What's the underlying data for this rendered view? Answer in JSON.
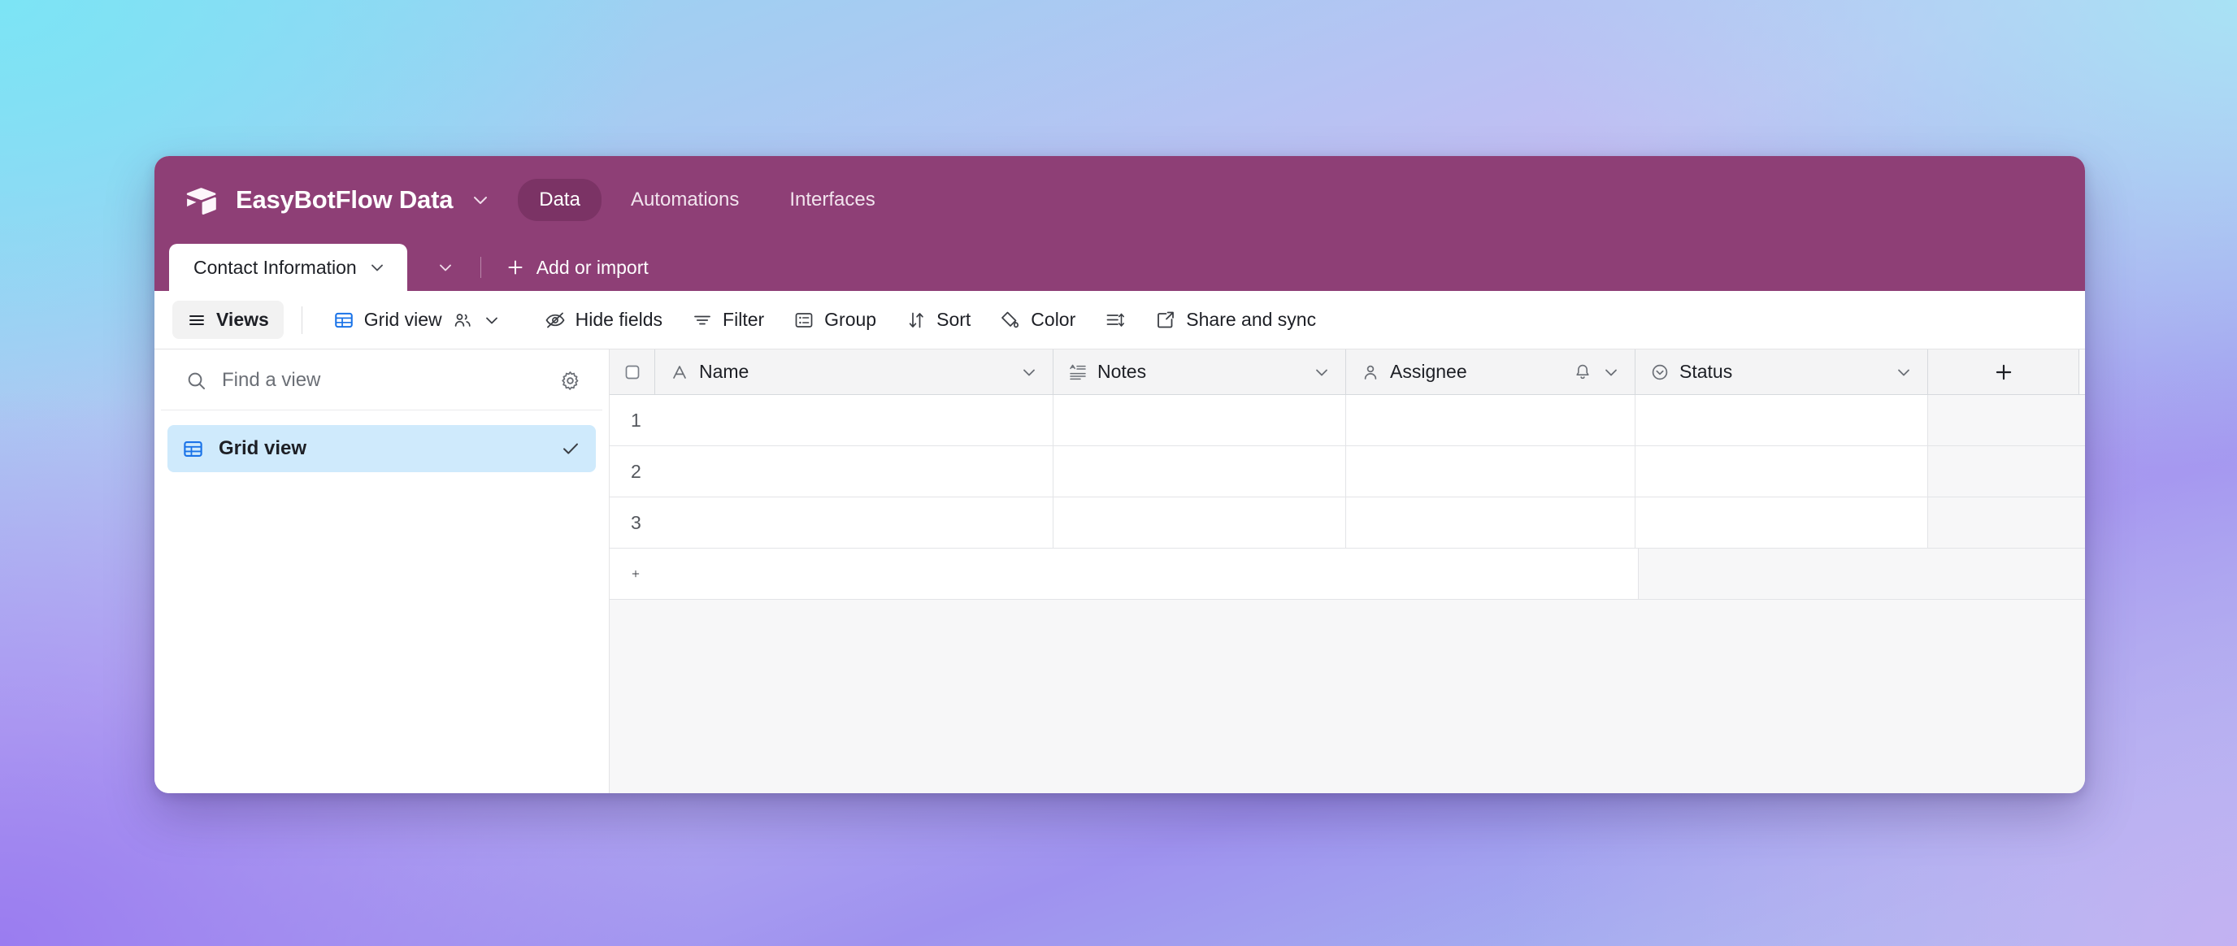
{
  "appbar": {
    "logo_icon": "airtable-cube-icon",
    "base_name": "EasyBotFlow Data",
    "base_chevron_icon": "chevron-down-icon",
    "nav": [
      {
        "label": "Data",
        "active": true
      },
      {
        "label": "Automations",
        "active": false
      },
      {
        "label": "Interfaces",
        "active": false
      }
    ],
    "bg_color": "#8E3F76",
    "active_pill_color": "#7B3365"
  },
  "tabstrip": {
    "active_tab_label": "Contact Information",
    "active_tab_chevron_icon": "chevron-down-icon",
    "tab_list_chevron_icon": "chevron-down-icon",
    "add_icon": "plus-icon",
    "add_label": "Add or import"
  },
  "toolbar": {
    "views_icon": "hamburger-icon",
    "views_label": "Views",
    "grid_view_icon": "grid-table-icon",
    "grid_view_label": "Grid view",
    "collaborators_icon": "people-icon",
    "grid_view_chevron_icon": "chevron-down-icon",
    "hide_fields_icon": "eye-off-icon",
    "hide_fields_label": "Hide fields",
    "filter_icon": "filter-icon",
    "filter_label": "Filter",
    "group_icon": "group-icon",
    "group_label": "Group",
    "sort_icon": "sort-arrows-icon",
    "sort_label": "Sort",
    "color_icon": "paint-drop-icon",
    "color_label": "Color",
    "row_height_icon": "row-height-icon",
    "share_icon": "share-external-icon",
    "share_label": "Share and sync"
  },
  "sidebar": {
    "search_icon": "search-icon",
    "search_placeholder": "Find a view",
    "search_value": "",
    "settings_icon": "gear-icon",
    "views": [
      {
        "label": "Grid view",
        "icon": "grid-table-icon",
        "selected": true,
        "check_icon": "check-icon"
      }
    ],
    "selected_bg_color": "#CFEAFC"
  },
  "grid": {
    "select_all_icon": "checkbox-empty-icon",
    "columns": [
      {
        "label": "Name",
        "type_icon": "text-A-icon",
        "chevron_icon": "chevron-down-icon"
      },
      {
        "label": "Notes",
        "type_icon": "long-text-icon",
        "chevron_icon": "chevron-down-icon"
      },
      {
        "label": "Assignee",
        "type_icon": "person-icon",
        "bell_icon": "bell-icon",
        "chevron_icon": "chevron-down-icon"
      },
      {
        "label": "Status",
        "type_icon": "check-circle-icon",
        "chevron_icon": "chevron-down-icon"
      }
    ],
    "add_field_icon": "plus-icon",
    "rows": [
      {
        "number": "1",
        "Name": "",
        "Notes": "",
        "Assignee": "",
        "Status": ""
      },
      {
        "number": "2",
        "Name": "",
        "Notes": "",
        "Assignee": "",
        "Status": ""
      },
      {
        "number": "3",
        "Name": "",
        "Notes": "",
        "Assignee": "",
        "Status": ""
      }
    ],
    "add_row_icon": "plus-icon"
  }
}
